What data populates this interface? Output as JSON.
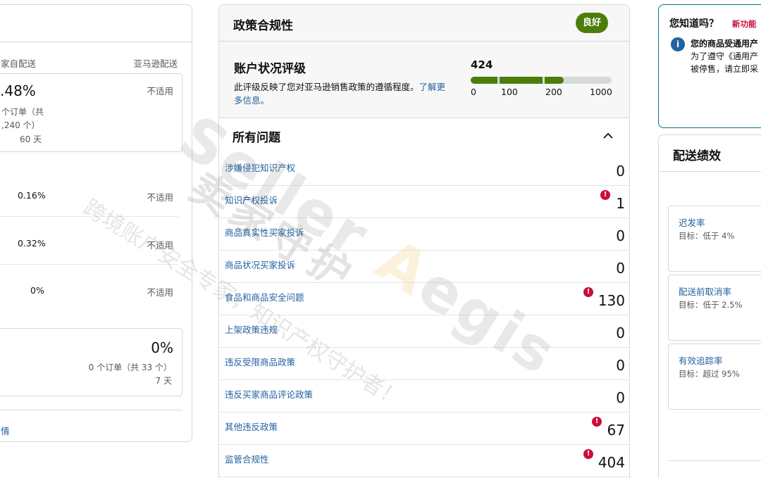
{
  "left_panel": {
    "col_seller": "家自配送",
    "col_amazon": "亚马逊配送",
    "box1": {
      "pct": ".48%",
      "line1": "个订单（共",
      "line2": ",240 个）",
      "line3": "60 天",
      "na": "不适用"
    },
    "rows": [
      {
        "value": "0.16%",
        "na": "不适用"
      },
      {
        "value": "0.32%",
        "na": "不适用"
      },
      {
        "value": "0%",
        "na": "不适用"
      }
    ],
    "box2": {
      "pct": "0%",
      "line1": "0 个订单（共 33 个）",
      "line2": "7 天"
    },
    "link": "情"
  },
  "policy": {
    "title": "政策合规性",
    "status_badge": "良好",
    "ahr_title": "账户状况评级",
    "ahr_desc": "此评级反映了您对亚马逊销售政策的遵循程度。",
    "ahr_link": "了解更多信息。",
    "score": "424",
    "score_value": 424,
    "score_max": 1000,
    "ticks": [
      "0",
      "100",
      "200",
      "1000"
    ],
    "issues_title": "所有问题",
    "issues": [
      {
        "label": "涉嫌侵犯知识产权",
        "count": "0",
        "alert": false
      },
      {
        "label": "知识产权投诉",
        "count": "1",
        "alert": true
      },
      {
        "label": "商品真实性买家投诉",
        "count": "0",
        "alert": false
      },
      {
        "label": "商品状况买家投诉",
        "count": "0",
        "alert": false
      },
      {
        "label": "食品和商品安全问题",
        "count": "130",
        "alert": true
      },
      {
        "label": "上架政策违规",
        "count": "0",
        "alert": false
      },
      {
        "label": "违反受限商品政策",
        "count": "0",
        "alert": false
      },
      {
        "label": "违反买家商品评论政策",
        "count": "0",
        "alert": false
      },
      {
        "label": "其他违反政策",
        "count": "67",
        "alert": true
      },
      {
        "label": "监管合规性",
        "count": "404",
        "alert": true
      }
    ]
  },
  "tip": {
    "title": "您知道吗？",
    "new_label": "新功能",
    "line1": "您的商品受通用产",
    "line2": "为了遵守《通用产",
    "line3": "被停售，请立即采"
  },
  "shipping": {
    "title": "配送绩效",
    "metrics": [
      {
        "label": "迟发率",
        "target": "目标：低于 4%"
      },
      {
        "label": "配送前取消率",
        "target": "目标：低于 2.5%"
      },
      {
        "label": "有效追踪率",
        "target": "目标：超过 95%"
      }
    ]
  },
  "watermark": {
    "en_a": "Seller ",
    "en_b": "A",
    "en_c": "egis",
    "cn": "卖家守护",
    "small": "跨境账户安全专家，知识产权守护者！"
  },
  "colors": {
    "accent_green": "#4c7d0a",
    "link_blue": "#2162a1",
    "alert_red": "#cc0c39"
  }
}
